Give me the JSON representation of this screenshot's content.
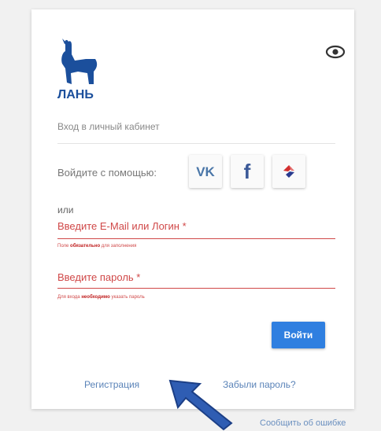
{
  "brand": {
    "logo_text": "ЛАНЬ",
    "color": "#1b4f9c"
  },
  "header": {
    "subtitle": "Вход в личный кабинет",
    "visibility_icon": "eye-icon"
  },
  "social": {
    "label": "Войдите с помощью:",
    "providers": [
      {
        "name": "vk-icon",
        "glyph": "VK",
        "color": "#4a76a8"
      },
      {
        "name": "facebook-icon",
        "glyph": "f",
        "color": "#3b5998"
      },
      {
        "name": "mos-icon",
        "glyph": "",
        "color": "#d32f2f"
      }
    ]
  },
  "or_label": "или",
  "form": {
    "login": {
      "placeholder": "Введите E-Mail или Логин *",
      "hint_prefix": "Поле ",
      "hint_bold": "обязательно",
      "hint_suffix": " для заполнения"
    },
    "password": {
      "placeholder": "Введите пароль *",
      "hint_prefix": "Для входа ",
      "hint_bold": "необходимо",
      "hint_suffix": " указать пароль"
    },
    "submit_label": "Войти"
  },
  "links": {
    "register": "Регистрация",
    "forgot": "Забыли пароль?",
    "report_error": "Сообщить об ошибке"
  },
  "colors": {
    "accent": "#2f7fe0",
    "error": "#d04848",
    "link": "#5a83b8",
    "annotation_arrow": "#2f5db3"
  }
}
